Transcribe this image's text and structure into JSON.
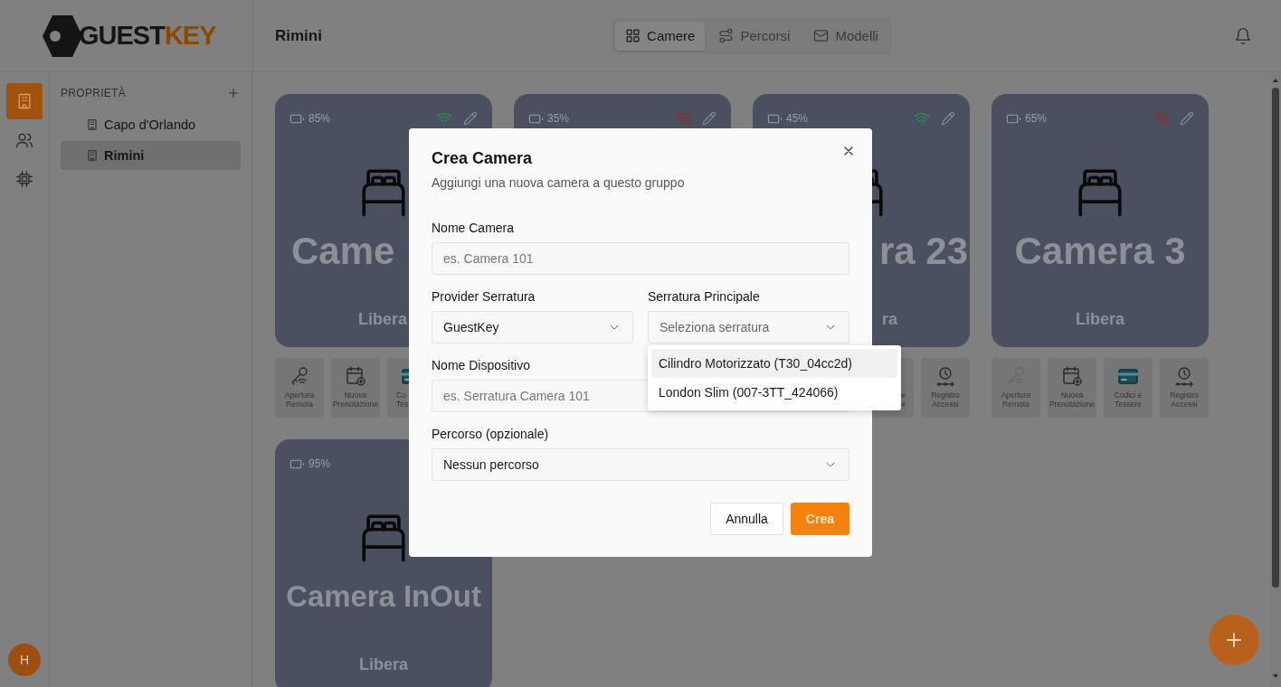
{
  "logo": {
    "dark": "GUEST",
    "accent": "KEY"
  },
  "rail": [
    {
      "selected": true
    },
    {
      "selected": false
    },
    {
      "selected": false
    }
  ],
  "avatar": {
    "initial": "H"
  },
  "properties": {
    "heading": "PROPRIETÀ",
    "items": [
      {
        "label": "Capo d'Orlando",
        "selected": false
      },
      {
        "label": "Rimini",
        "selected": true
      }
    ]
  },
  "header": {
    "title": "Rimini",
    "tabs": [
      {
        "label": "Camere",
        "selected": true
      },
      {
        "label": "Percorsi",
        "selected": false
      },
      {
        "label": "Modelli",
        "selected": false
      }
    ]
  },
  "cards": [
    {
      "battery": "85%",
      "online": true,
      "name": "Came",
      "status": "Libera",
      "actions": [
        {
          "kind": "remote",
          "label": "Apertura Remota",
          "disabled": false
        },
        {
          "kind": "booking",
          "label": "Nuova Prenotazione",
          "disabled": false
        },
        {
          "kind": "codes",
          "label": "Co\nTes",
          "disabled": false
        }
      ]
    },
    {
      "battery": "35%",
      "online": false
    },
    {
      "battery": "45%",
      "online": true,
      "name": "ra 23",
      "status": "ra",
      "actions": [
        {
          "label": "e\ne"
        },
        {
          "kind": "log",
          "label": "Registro Accessi",
          "disabled": false
        }
      ]
    },
    {
      "battery": "65%",
      "online": false,
      "name": "Camera 3",
      "status": "Libera",
      "actions": [
        {
          "kind": "remote",
          "label": "Apertura Remota",
          "disabled": true
        },
        {
          "kind": "booking",
          "label": "Nuova Prenotazione",
          "disabled": false
        },
        {
          "kind": "codes",
          "label": "Codici e Tessere",
          "disabled": false
        },
        {
          "kind": "log",
          "label": "Registro Accessi",
          "disabled": false
        }
      ]
    },
    {
      "battery": "95%",
      "name": "Camera InOut",
      "status": "Libera"
    }
  ],
  "modal": {
    "title": "Crea Camera",
    "subtitle": "Aggiungi una nuova camera a questo gruppo",
    "rows": [
      [
        {
          "kind": "text",
          "label": "Nome Camera",
          "placeholder": "es. Camera 101"
        }
      ],
      [
        {
          "kind": "select",
          "label": "Provider Serratura",
          "value": "GuestKey"
        },
        {
          "kind": "select",
          "label": "Serratura Principale",
          "placeholder": "Seleziona serratura",
          "open": true,
          "options": [
            {
              "label": "Cilindro Motorizzato (T30_04cc2d)",
              "highlighted": true
            },
            {
              "label": "London Slim (007-3TT_424066)",
              "highlighted": false
            }
          ]
        }
      ],
      [
        {
          "kind": "text",
          "label": "Nome Dispositivo",
          "placeholder": "es. Serratura Camera 101"
        }
      ],
      [
        {
          "kind": "select",
          "label": "Percorso (opzionale)",
          "value": "Nessun percorso"
        }
      ]
    ],
    "buttons": [
      {
        "kind": "secondary",
        "label": "Annulla"
      },
      {
        "kind": "primary",
        "label": "Crea"
      }
    ]
  }
}
